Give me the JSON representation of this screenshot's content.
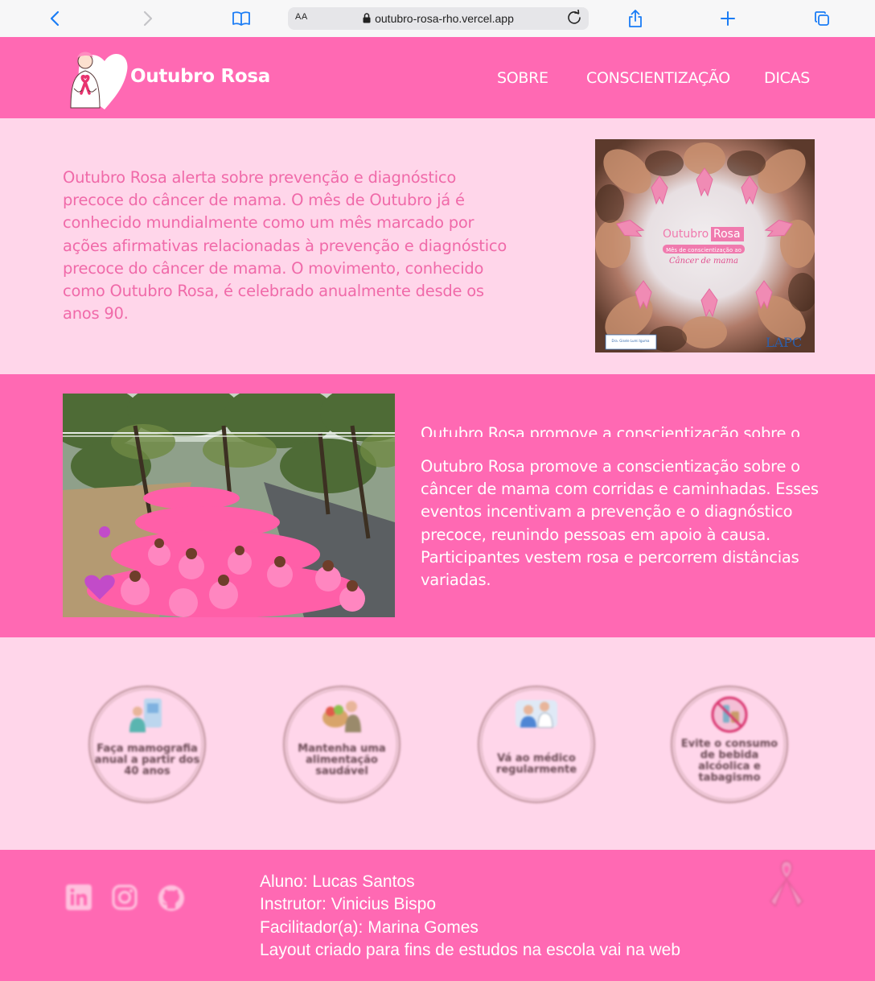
{
  "browser": {
    "text_size_label": "AA",
    "url": "outubro-rosa-rho.vercel.app",
    "accent_color": "#1a7cf5",
    "icons": [
      "chevron-left-icon",
      "chevron-right-icon",
      "book-icon",
      "lock-icon",
      "reload-icon",
      "share-icon",
      "plus-icon",
      "tabs-icon"
    ]
  },
  "header": {
    "brand": "Outubro Rosa",
    "nav": [
      "SOBRE",
      "CONSCIENTIZAÇÃO",
      "DICAS"
    ],
    "background": "#ff69b3"
  },
  "about": {
    "text": "Outubro Rosa alerta sobre prevenção e diagnóstico precoce do câncer de mama. O mês de Outubro já é conhecido mundialmente como um mês marcado por ações afirmativas relacionadas à prevenção e diagnóstico precoce do câncer de mama. O movimento, conhecido como Outubro Rosa, é celebrado anualmente desde os anos 90.",
    "image": {
      "title_a": "Outubro",
      "title_b": "Rosa",
      "subtitle": "Mês de conscientização ao",
      "script": "Câncer de mama",
      "signature": "Dra. Gisele Lumi Iguma",
      "brand_mark": "LAPC"
    }
  },
  "awareness": {
    "ghost_text": "Outubro Rosa promove a conscientização sobre o",
    "text": "Outubro Rosa promove a conscientização sobre o câncer de mama com corridas e caminhadas. Esses eventos incentivam a prevenção e o diagnóstico precoce, reunindo pessoas em apoio à causa. Participantes vestem rosa e percorrem distâncias variadas."
  },
  "tips": [
    {
      "label": "Faça mamografia anual a partir dos 40 anos",
      "icon": "mammography-icon"
    },
    {
      "label": "Mantenha uma alimentação saudável",
      "icon": "healthy-food-icon"
    },
    {
      "label": "Vá ao médico regularmente",
      "icon": "doctor-visit-icon"
    },
    {
      "label": "Evite o consumo de bebida alcóolica e tabagismo",
      "icon": "no-alcohol-icon"
    }
  ],
  "footer": {
    "social": [
      "linkedin-icon",
      "instagram-icon",
      "github-icon"
    ],
    "credits": [
      "Aluno: Lucas Santos",
      "Instrutor: Vinicius Bispo",
      "Facilitador(a): Marina Gomes",
      "Layout criado para fins de estudos na escola vai na web"
    ]
  }
}
